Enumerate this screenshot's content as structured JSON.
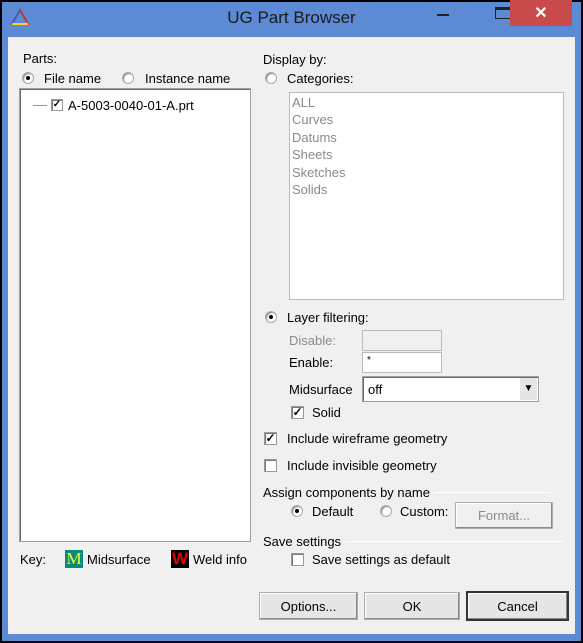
{
  "window": {
    "title": "UG Part Browser",
    "close_icon": "close-icon",
    "minimize_icon": "minimize-icon",
    "maximize_icon": "maximize-icon"
  },
  "parts": {
    "label": "Parts:",
    "file_name": "File name",
    "instance_name": "Instance name",
    "selected": "File name",
    "tree": [
      {
        "label": "A-5003-0040-01-A.prt",
        "checked": true
      }
    ]
  },
  "key": {
    "label": "Key:",
    "midsurface": "Midsurface",
    "midsurface_glyph": "M",
    "weld": "Weld info",
    "weld_glyph": "W",
    "midsurface_color": "#0a8a7a",
    "weld_color": "#e00000"
  },
  "display": {
    "label": "Display by:",
    "categories": "Categories:",
    "categories_selected": false,
    "category_items": [
      "ALL",
      "Curves",
      "Datums",
      "Sheets",
      "Sketches",
      "Solids"
    ],
    "layer_filtering": "Layer filtering:",
    "layer_selected": true,
    "disable_label": "Disable:",
    "disable_value": "",
    "enable_label": "Enable:",
    "enable_value": "*",
    "midsurface_label": "Midsurface",
    "midsurface_value": "off",
    "solid_label": "Solid",
    "solid_checked": true,
    "wireframe_label": "Include wireframe geometry",
    "wireframe_checked": true,
    "invisible_label": "Include invisible geometry",
    "invisible_checked": false
  },
  "assign": {
    "label": "Assign components by name",
    "default": "Default",
    "custom": "Custom:",
    "format": "Format...",
    "selected": "Default"
  },
  "save": {
    "label": "Save settings",
    "default_label": "Save settings as default",
    "checked": false
  },
  "buttons": {
    "options": "Options...",
    "ok": "OK",
    "cancel": "Cancel"
  }
}
